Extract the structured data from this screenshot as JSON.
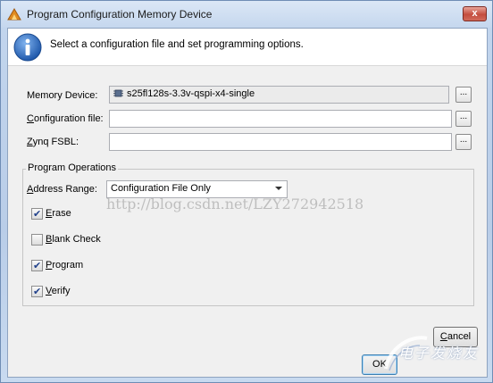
{
  "window": {
    "title": "Program Configuration Memory Device",
    "close_label": "x"
  },
  "info": {
    "message": "Select a configuration file and set programming options."
  },
  "fields": {
    "memory_device": {
      "label": "Memory Device:",
      "value": "s25fl128s-3.3v-qspi-x4-single",
      "browse": "..."
    },
    "configuration_file": {
      "label_u": "C",
      "label_rest": "onfiguration file:",
      "value": "",
      "browse": "..."
    },
    "zynq_fsbl": {
      "label_u": "Z",
      "label_rest": "ynq FSBL:",
      "value": "",
      "browse": "..."
    }
  },
  "program_operations": {
    "title": "Program Operations",
    "address_range": {
      "label_u": "A",
      "label_rest": "ddress Range:",
      "value": "Configuration File Only"
    },
    "checkboxes": [
      {
        "label_u": "E",
        "label_rest": "rase",
        "checked": true
      },
      {
        "label_u": "B",
        "label_rest": "lank Check",
        "checked": false
      },
      {
        "label_u": "P",
        "label_rest": "rogram",
        "checked": true
      },
      {
        "label_u": "V",
        "label_rest": "erify",
        "checked": true
      }
    ]
  },
  "watermark": "http://blog.csdn.net/LZY272942518",
  "buttons": {
    "ok": "OK",
    "cancel_u": "C",
    "cancel_rest": "ancel"
  },
  "logo": {
    "text": "电子发烧友"
  },
  "colors": {
    "info_blue": "#2a64b8",
    "check_blue": "#21418b",
    "close_red": "#c44d3e"
  }
}
